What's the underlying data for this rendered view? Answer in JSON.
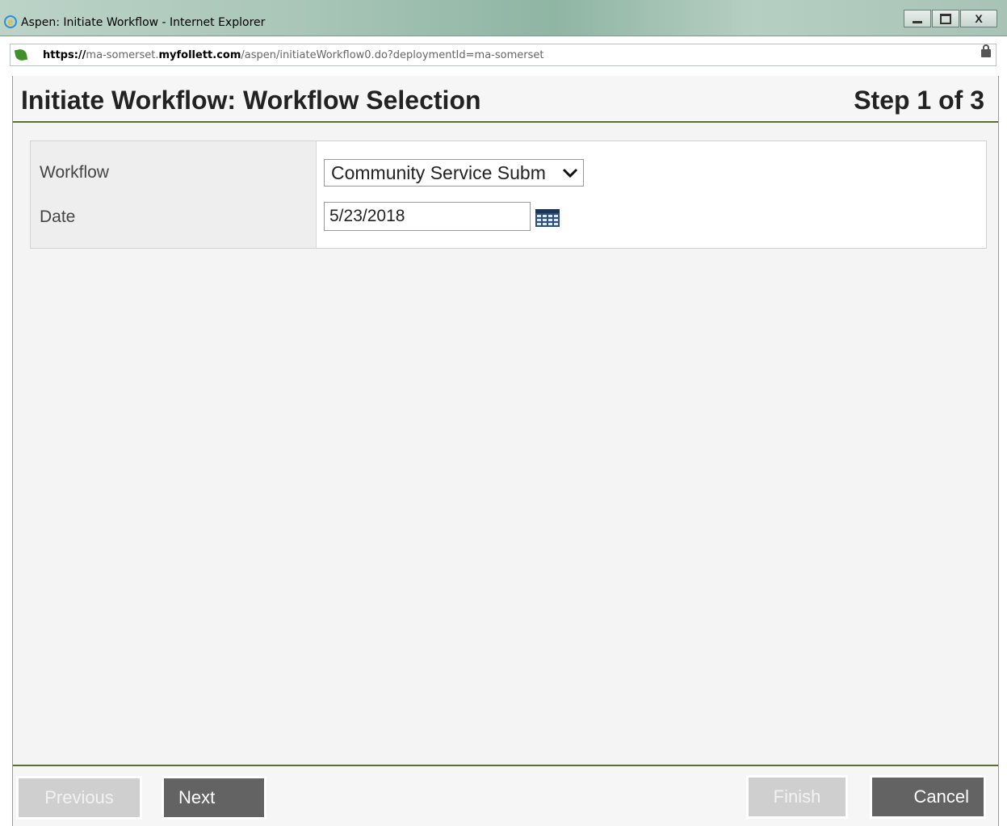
{
  "window": {
    "title": "Aspen: Initiate Workflow - Internet Explorer",
    "controls": {
      "minimize": "—",
      "maximize": "▢",
      "close": "X"
    }
  },
  "address": {
    "protocol": "https://",
    "pre_host": "ma-somerset.",
    "host_bold": "myfollett.com",
    "path": "/aspen/initiateWorkflow0.do?deploymentId=ma-somerset"
  },
  "dialog": {
    "title": "Initiate Workflow: Workflow Selection",
    "step": "Step 1 of 3"
  },
  "form": {
    "workflow_label": "Workflow",
    "workflow_value": "Community Service Subm",
    "date_label": "Date",
    "date_value": "5/23/2018"
  },
  "footer": {
    "previous": "Previous",
    "next": "Next",
    "finish": "Finish",
    "cancel": "Cancel"
  },
  "colors": {
    "header_rule": "#5d6e31",
    "button_enabled": "#636363",
    "button_disabled": "#cfcfcf"
  }
}
